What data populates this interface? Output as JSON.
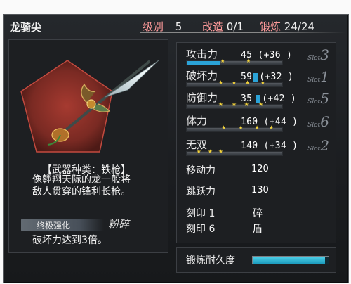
{
  "weapon": {
    "name": "龙骑尖",
    "level_label": "级别",
    "level_value": "5",
    "modify_label": "改造",
    "modify_value": "0/1",
    "forge_label": "锻炼",
    "forge_value": "24/24",
    "type_text": "【武器种类：铁枪】",
    "description": [
      "像翱翔天际的龙一般将",
      "敌人贯穿的锋利长枪。"
    ],
    "ultimate_label": "终极强化",
    "ultimate_name": "粉碎",
    "ultimate_desc": "破坏力达到3倍。"
  },
  "stats": [
    {
      "label": "攻击力",
      "value": "45 (+36 )",
      "slot_prefix": "Slot",
      "slot_number": "3",
      "fill": 0.35,
      "stars": [
        0.35,
        0.62
      ]
    },
    {
      "label": "破坏力",
      "value": "59",
      "value_extra": "(+32 )",
      "slot_prefix": "Slot",
      "slot_number": "1",
      "fill": 0.0,
      "stars": [
        0.33,
        0.47,
        0.61,
        0.77
      ]
    },
    {
      "label": "防御力",
      "value": "35",
      "value_extra": "(+42 )",
      "slot_prefix": "Slot",
      "slot_number": "5",
      "fill": 0.0,
      "stars": [
        0.33,
        0.47,
        0.6,
        0.75
      ]
    },
    {
      "label": "体力",
      "value": "160 (+44 )",
      "slot_prefix": "Slot",
      "slot_number": "6",
      "fill": 0.0,
      "stars": [
        0.36,
        0.54,
        0.71,
        0.86
      ]
    },
    {
      "label": "无双",
      "value": "140 (+34 )",
      "slot_prefix": "Slot",
      "slot_number": "2",
      "fill": 0.0,
      "stars": [
        0.1,
        0.22,
        0.33
      ]
    }
  ],
  "extra_stats": [
    {
      "label": "移动力",
      "value": "120"
    },
    {
      "label": "跳跃力",
      "value": "130"
    },
    {
      "label": "刻印 1",
      "value": "碎"
    },
    {
      "label": "刻印 6",
      "value": "盾"
    }
  ],
  "durability": {
    "label": "锻炼耐久度",
    "fill": 0.95
  },
  "colors": {
    "accent": "#2ba3d8",
    "header_label": "#ff9b9b",
    "star": "#f2d23a",
    "pentagon": "#8a2e26"
  }
}
